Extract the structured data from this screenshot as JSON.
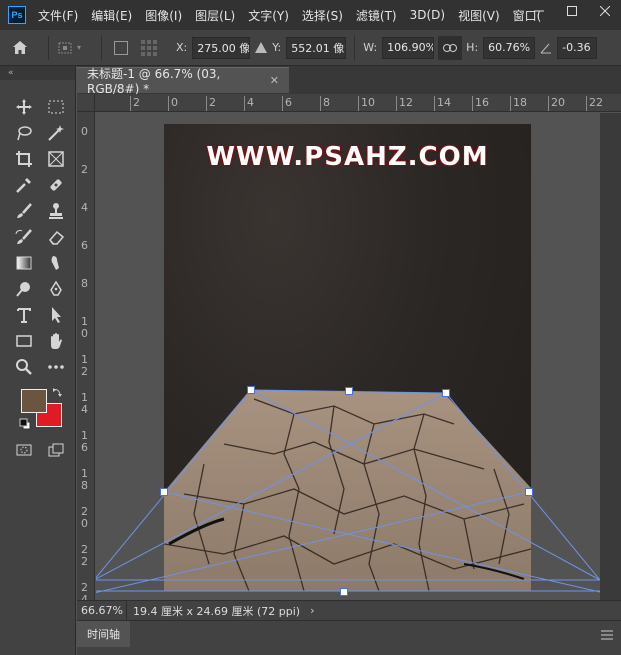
{
  "app": {
    "logo": "Ps",
    "menu": [
      "文件(F)",
      "编辑(E)",
      "图像(I)",
      "图层(L)",
      "文字(Y)",
      "选择(S)",
      "滤镜(T)",
      "3D(D)",
      "视图(V)",
      "窗口("
    ],
    "window_controls": [
      "minimize-icon",
      "maximize-icon",
      "close-icon"
    ]
  },
  "options": {
    "x_label": "X:",
    "x_value": "275.00 像素",
    "y_label": "Y:",
    "y_value": "552.01 像素",
    "w_label": "W:",
    "w_value": "106.90%",
    "h_label": "H:",
    "h_value": "60.76%",
    "angle_value": "-0.36"
  },
  "document": {
    "tab_title": "未标题-1 @ 66.7% (03, RGB/8#) *",
    "watermark": "WWW.PSAHZ.COM"
  },
  "ruler": {
    "h_labels": [
      "2",
      "0",
      "2",
      "4",
      "6",
      "8",
      "10",
      "12",
      "14",
      "16",
      "18",
      "20",
      "22"
    ],
    "v_labels": [
      "0",
      "2",
      "4",
      "6",
      "8",
      "1\n0",
      "1\n2",
      "1\n4",
      "1\n6",
      "1\n8",
      "2\n0",
      "2\n2",
      "2\n4"
    ]
  },
  "status": {
    "zoom": "66.67%",
    "doc_info": "19.4 厘米 x 24.69 厘米 (72 ppi)",
    "arrow": "›"
  },
  "timeline": {
    "tab": "时间轴"
  },
  "colors": {
    "foreground": "#6b5540",
    "background": "#e01b24",
    "accent": "#31a8ff",
    "transform_line": "#6f93e8"
  }
}
